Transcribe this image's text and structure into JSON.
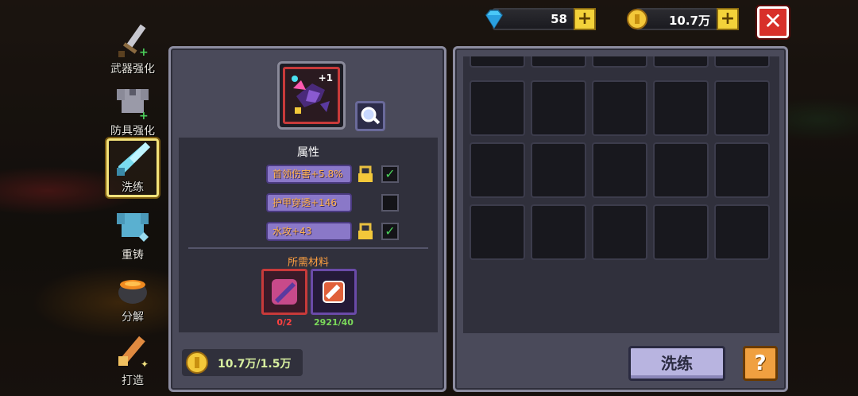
{
  "sidebar": {
    "tabs": [
      {
        "label": "武器强化",
        "icon": "sword-icon"
      },
      {
        "label": "防具强化",
        "icon": "armor-icon"
      },
      {
        "label": "洗练",
        "icon": "crystal-blade-icon",
        "active": true
      },
      {
        "label": "重铸",
        "icon": "armor-reforge-icon"
      },
      {
        "label": "分解",
        "icon": "cauldron-icon"
      },
      {
        "label": "打造",
        "icon": "hammer-icon"
      }
    ]
  },
  "currency": {
    "gems": "58",
    "coins": "10.7万"
  },
  "item": {
    "level": "+1",
    "icon": "purple-weapon-icon"
  },
  "attributes": {
    "title": "属性",
    "rows": [
      {
        "text": "首领伤害+5.8%",
        "locked": true,
        "checked": true
      },
      {
        "text": "护甲穿透+146",
        "locked": false,
        "checked": false
      },
      {
        "text": "水攻+43",
        "locked": true,
        "checked": true
      }
    ]
  },
  "materials": {
    "title": "所需材料",
    "items": [
      {
        "icon": "purple-gem-material-icon",
        "count": "0/2",
        "count_color": "#ff4040"
      },
      {
        "icon": "red-ore-material-icon",
        "count": "2921/40",
        "count_color": "#7ad85a"
      }
    ]
  },
  "cost": "10.7万/1.5万",
  "actions": {
    "refine": "洗练",
    "help": "?",
    "close": "✕"
  },
  "colors": {
    "panel": "#4a4a5a",
    "accent_gold": "#f3d23a",
    "close_red": "#d8302a"
  }
}
